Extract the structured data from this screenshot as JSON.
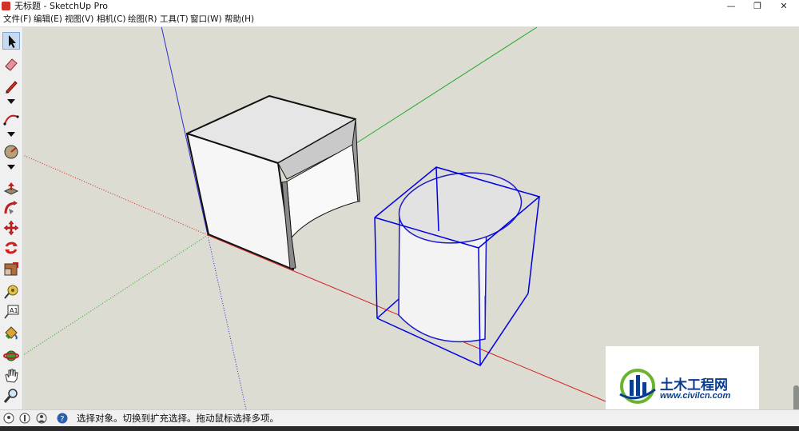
{
  "window": {
    "title": "无标题 - SketchUp Pro",
    "minimize": "—",
    "restore": "❐",
    "close": "✕"
  },
  "menu": [
    "文件(F)",
    "编辑(E)",
    "视图(V)",
    "相机(C)",
    "绘图(R)",
    "工具(T)",
    "窗口(W)",
    "帮助(H)"
  ],
  "toolbar": {
    "items": [
      "select-icon",
      "eraser-icon",
      "pencil-icon",
      "arc-icon",
      "circle-icon",
      "push-pull-icon",
      "follow-me-icon",
      "move-icon",
      "rotate-icon",
      "scale-icon",
      "tape-measure-icon",
      "text-icon",
      "paint-bucket-icon",
      "orbit-icon",
      "pan-icon",
      "zoom-icon"
    ],
    "active": "select-icon"
  },
  "status": {
    "message": "选择对象。切换到扩充选择。拖动鼠标选择多项。"
  },
  "watermark": {
    "name": "土木工程网",
    "url": "www.civilcn.com"
  },
  "colors": {
    "viewport_bg": "#dcdcd2",
    "axis_blue": "#2a2ad6",
    "axis_green": "#22aa22",
    "axis_red": "#d42020",
    "selection": "#0000e6",
    "watermark_blue": "#0a3d8f",
    "watermark_green": "#6ab42d"
  }
}
